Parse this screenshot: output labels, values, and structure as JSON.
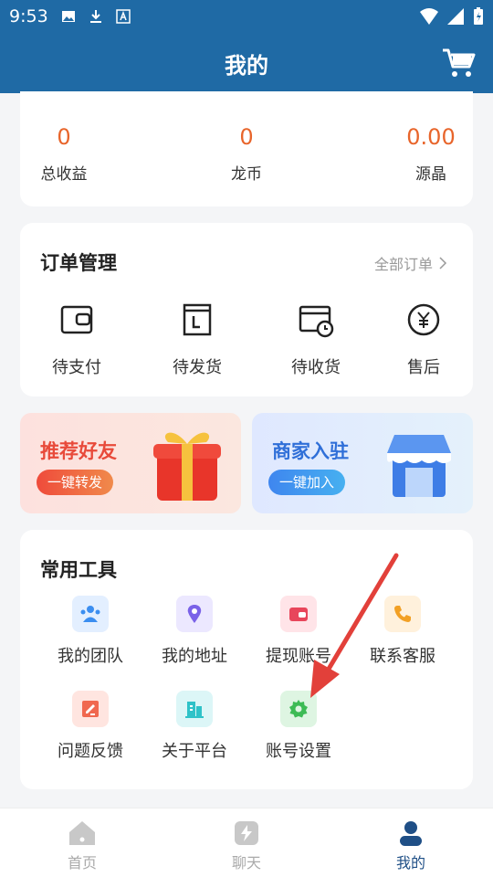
{
  "status_bar": {
    "time": "9:53"
  },
  "header": {
    "title": "我的"
  },
  "stats": [
    {
      "value": "0",
      "label": "总收益"
    },
    {
      "value": "0",
      "label": "龙币"
    },
    {
      "value": "0.00",
      "label": "源晶"
    }
  ],
  "orders": {
    "title": "订单管理",
    "all_link": "全部订单",
    "items": [
      {
        "label": "待支付",
        "icon": "wallet-icon"
      },
      {
        "label": "待发货",
        "icon": "box-icon"
      },
      {
        "label": "待收货",
        "icon": "delivery-clock-icon"
      },
      {
        "label": "售后",
        "icon": "yen-icon"
      }
    ]
  },
  "banners": {
    "invite": {
      "title": "推荐好友",
      "button": "一键转发",
      "icon": "gift-icon"
    },
    "merchant": {
      "title": "商家入驻",
      "button": "一键加入",
      "icon": "shop-icon"
    }
  },
  "tools": {
    "title": "常用工具",
    "items": [
      {
        "label": "我的团队",
        "icon": "team-icon",
        "color": "#3b8ef0"
      },
      {
        "label": "我的地址",
        "icon": "location-icon",
        "color": "#7a62e8"
      },
      {
        "label": "提现账号",
        "icon": "wallet-icon",
        "color": "#e8465b"
      },
      {
        "label": "联系客服",
        "icon": "phone-icon",
        "color": "#f2a024"
      },
      {
        "label": "问题反馈",
        "icon": "feedback-icon",
        "color": "#f0684f"
      },
      {
        "label": "关于平台",
        "icon": "building-icon",
        "color": "#2fc2c8"
      },
      {
        "label": "账号设置",
        "icon": "gear-icon",
        "color": "#3dbb55"
      }
    ]
  },
  "tabbar": [
    {
      "label": "首页",
      "icon": "home-icon",
      "active": false
    },
    {
      "label": "聊天",
      "icon": "chat-icon",
      "active": false
    },
    {
      "label": "我的",
      "icon": "user-icon",
      "active": true
    }
  ],
  "colors": {
    "primary": "#1f6aa5",
    "accent": "#e8652b",
    "annotation_arrow": "#e2403a"
  }
}
